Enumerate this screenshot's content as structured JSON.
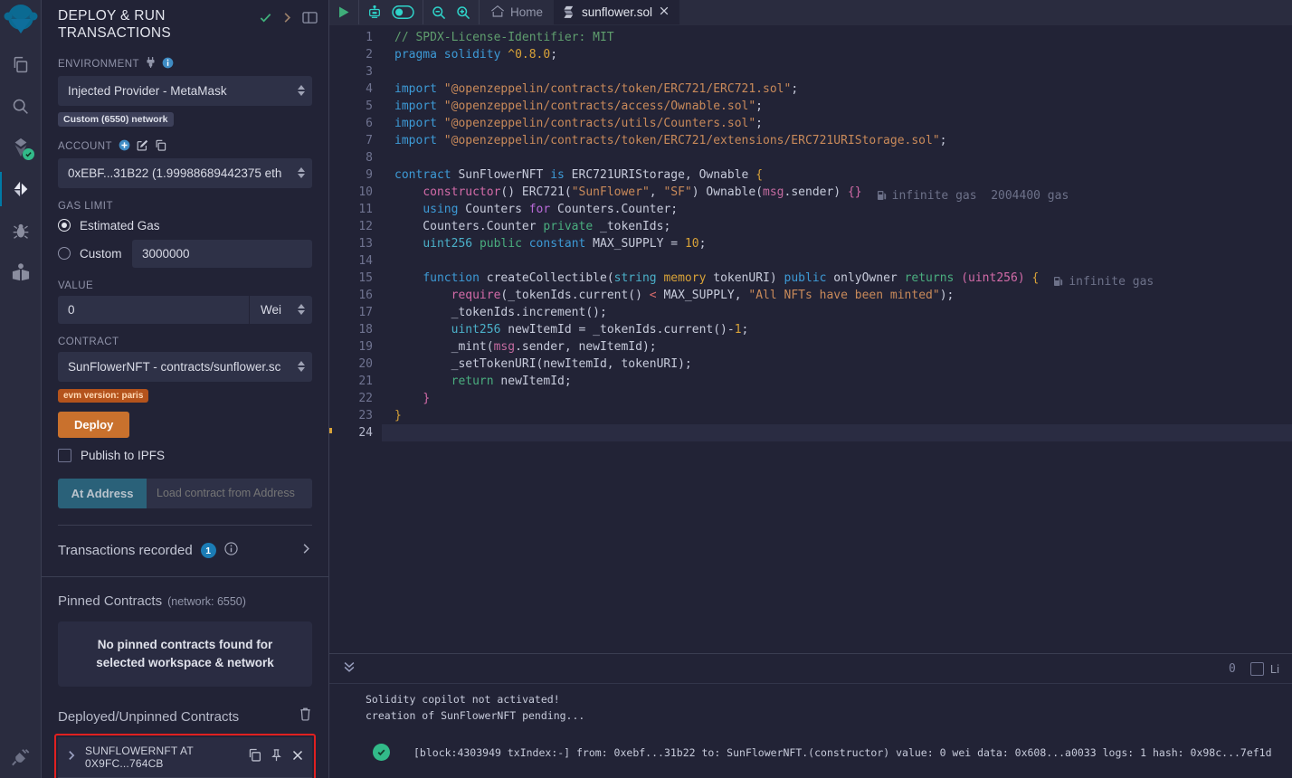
{
  "rail": {
    "items": [
      {
        "name": "remix-logo-icon",
        "label": "Remix"
      },
      {
        "name": "file-explorer-icon",
        "label": "File explorer"
      },
      {
        "name": "search-icon",
        "label": "Search in files"
      },
      {
        "name": "solidity-compiler-icon",
        "label": "Solidity compiler"
      },
      {
        "name": "deploy-run-icon",
        "label": "Deploy & run transactions"
      },
      {
        "name": "debugger-icon",
        "label": "Debugger"
      },
      {
        "name": "learneth-icon",
        "label": "LearnEth"
      }
    ],
    "bottom": {
      "name": "plugin-manager-icon",
      "label": "Plugin manager"
    }
  },
  "sidepanel": {
    "title": "DEPLOY & RUN TRANSACTIONS",
    "environment": {
      "label": "ENVIRONMENT",
      "value": "Injected Provider - MetaMask",
      "network_badge": "Custom (6550) network"
    },
    "account": {
      "label": "ACCOUNT",
      "value": "0xEBF...31B22 (1.99988689442375 eth"
    },
    "gas_limit": {
      "label": "GAS LIMIT",
      "estimated_label": "Estimated Gas",
      "custom_label": "Custom",
      "custom_value": "3000000",
      "selected": "estimated"
    },
    "value": {
      "label": "VALUE",
      "amount": "0",
      "unit": "Wei"
    },
    "contract": {
      "label": "CONTRACT",
      "value": "SunFlowerNFT - contracts/sunflower.sc",
      "evm_badge": "evm version: paris"
    },
    "deploy_button": "Deploy",
    "publish_ipfs_label": "Publish to IPFS",
    "at_address_button": "At Address",
    "at_address_placeholder": "Load contract from Address",
    "transactions_recorded": {
      "label": "Transactions recorded",
      "count": "1"
    },
    "pinned": {
      "title": "Pinned Contracts",
      "subtitle": "(network: 6550)",
      "empty_message": "No pinned contracts found for selected workspace & network"
    },
    "deployed": {
      "title": "Deployed/Unpinned Contracts",
      "items": [
        {
          "label": "SUNFLOWERNFT AT 0X9FC...764CB"
        }
      ]
    }
  },
  "toolbar": {
    "run_label": "Run script",
    "copilot_label": "Solidity copilot",
    "toggle_label": "Copilot toggle",
    "zoom_out_label": "Zoom out",
    "zoom_in_label": "Zoom in",
    "home_label": "Home",
    "tabs": [
      {
        "label": "sunflower.sol",
        "active": true
      }
    ]
  },
  "editor": {
    "cursor_line": 24,
    "total_lines": 24,
    "lines": [
      {
        "n": 1,
        "tokens": [
          {
            "t": "// SPDX-License-Identifier: MIT",
            "c": "k-comment"
          }
        ]
      },
      {
        "n": 2,
        "tokens": [
          {
            "t": "pragma",
            "c": "k-key"
          },
          {
            "t": " ",
            "c": ""
          },
          {
            "t": "solidity",
            "c": "k-key"
          },
          {
            "t": " ",
            "c": ""
          },
          {
            "t": "^0.8.0",
            "c": "k-num"
          },
          {
            "t": ";",
            "c": "k-ident"
          }
        ]
      },
      {
        "n": 3,
        "tokens": []
      },
      {
        "n": 4,
        "tokens": [
          {
            "t": "import",
            "c": "k-key"
          },
          {
            "t": " ",
            "c": ""
          },
          {
            "t": "\"@openzeppelin/contracts/token/ERC721/ERC721.sol\"",
            "c": "k-str"
          },
          {
            "t": ";",
            "c": "k-ident"
          }
        ]
      },
      {
        "n": 5,
        "tokens": [
          {
            "t": "import",
            "c": "k-key"
          },
          {
            "t": " ",
            "c": ""
          },
          {
            "t": "\"@openzeppelin/contracts/access/Ownable.sol\"",
            "c": "k-str"
          },
          {
            "t": ";",
            "c": "k-ident"
          }
        ]
      },
      {
        "n": 6,
        "tokens": [
          {
            "t": "import",
            "c": "k-key"
          },
          {
            "t": " ",
            "c": ""
          },
          {
            "t": "\"@openzeppelin/contracts/utils/Counters.sol\"",
            "c": "k-str"
          },
          {
            "t": ";",
            "c": "k-ident"
          }
        ]
      },
      {
        "n": 7,
        "tokens": [
          {
            "t": "import",
            "c": "k-key"
          },
          {
            "t": " ",
            "c": ""
          },
          {
            "t": "\"@openzeppelin/contracts/token/ERC721/extensions/ERC721URIStorage.sol\"",
            "c": "k-str"
          },
          {
            "t": ";",
            "c": "k-ident"
          }
        ]
      },
      {
        "n": 8,
        "tokens": []
      },
      {
        "n": 9,
        "tokens": [
          {
            "t": "contract",
            "c": "k-key"
          },
          {
            "t": " SunFlowerNFT ",
            "c": "k-ident"
          },
          {
            "t": "is",
            "c": "k-key"
          },
          {
            "t": " ERC721URIStorage, Ownable ",
            "c": "k-ident"
          },
          {
            "t": "{",
            "c": "k-brace"
          }
        ]
      },
      {
        "n": 10,
        "tokens": [
          {
            "t": "    ",
            "c": ""
          },
          {
            "t": "constructor",
            "c": "k-pink"
          },
          {
            "t": "() ERC721(",
            "c": "k-ident"
          },
          {
            "t": "\"SunFlower\"",
            "c": "k-str"
          },
          {
            "t": ", ",
            "c": "k-ident"
          },
          {
            "t": "\"SF\"",
            "c": "k-str"
          },
          {
            "t": ") Ownable(",
            "c": "k-ident"
          },
          {
            "t": "msg",
            "c": "k-msg"
          },
          {
            "t": ".sender) ",
            "c": "k-ident"
          },
          {
            "t": "{}",
            "c": "k-pink"
          }
        ],
        "gas": "infinite gas  2004400 gas"
      },
      {
        "n": 11,
        "tokens": [
          {
            "t": "    ",
            "c": ""
          },
          {
            "t": "using",
            "c": "k-key"
          },
          {
            "t": " Counters ",
            "c": "k-ident"
          },
          {
            "t": "for",
            "c": "k-key2"
          },
          {
            "t": " Counters.Counter;",
            "c": "k-ident"
          }
        ]
      },
      {
        "n": 12,
        "tokens": [
          {
            "t": "    Counters.Counter ",
            "c": "k-ident"
          },
          {
            "t": "private",
            "c": "k-green"
          },
          {
            "t": " _tokenIds;",
            "c": "k-ident"
          }
        ]
      },
      {
        "n": 13,
        "tokens": [
          {
            "t": "    ",
            "c": ""
          },
          {
            "t": "uint256",
            "c": "k-teal"
          },
          {
            "t": " ",
            "c": ""
          },
          {
            "t": "public",
            "c": "k-green"
          },
          {
            "t": " ",
            "c": ""
          },
          {
            "t": "constant",
            "c": "k-key"
          },
          {
            "t": " MAX_SUPPLY = ",
            "c": "k-ident"
          },
          {
            "t": "10",
            "c": "k-num"
          },
          {
            "t": ";",
            "c": "k-ident"
          }
        ]
      },
      {
        "n": 14,
        "tokens": []
      },
      {
        "n": 15,
        "tokens": [
          {
            "t": "    ",
            "c": ""
          },
          {
            "t": "function",
            "c": "k-key"
          },
          {
            "t": " createCollectible(",
            "c": "k-ident"
          },
          {
            "t": "string",
            "c": "k-teal"
          },
          {
            "t": " ",
            "c": ""
          },
          {
            "t": "memory",
            "c": "k-num"
          },
          {
            "t": " tokenURI) ",
            "c": "k-ident"
          },
          {
            "t": "public",
            "c": "k-key"
          },
          {
            "t": " onlyOwner ",
            "c": "k-ident"
          },
          {
            "t": "returns",
            "c": "k-green"
          },
          {
            "t": " ",
            "c": ""
          },
          {
            "t": "(uint256)",
            "c": "k-pink"
          },
          {
            "t": " ",
            "c": ""
          },
          {
            "t": "{",
            "c": "k-brace"
          }
        ],
        "gas": "infinite gas"
      },
      {
        "n": 16,
        "tokens": [
          {
            "t": "        ",
            "c": ""
          },
          {
            "t": "require",
            "c": "k-pink"
          },
          {
            "t": "(_tokenIds.current() ",
            "c": "k-ident"
          },
          {
            "t": "<",
            "c": "k-op"
          },
          {
            "t": " MAX_SUPPLY, ",
            "c": "k-ident"
          },
          {
            "t": "\"All NFTs have been minted\"",
            "c": "k-str"
          },
          {
            "t": ");",
            "c": "k-ident"
          }
        ]
      },
      {
        "n": 17,
        "tokens": [
          {
            "t": "        _tokenIds.increment();",
            "c": "k-ident"
          }
        ]
      },
      {
        "n": 18,
        "tokens": [
          {
            "t": "        ",
            "c": ""
          },
          {
            "t": "uint256",
            "c": "k-teal"
          },
          {
            "t": " newItemId = _tokenIds.current()-",
            "c": "k-ident"
          },
          {
            "t": "1",
            "c": "k-num"
          },
          {
            "t": ";",
            "c": "k-ident"
          }
        ]
      },
      {
        "n": 19,
        "tokens": [
          {
            "t": "        _mint(",
            "c": "k-ident"
          },
          {
            "t": "msg",
            "c": "k-msg"
          },
          {
            "t": ".sender, newItemId);",
            "c": "k-ident"
          }
        ]
      },
      {
        "n": 20,
        "tokens": [
          {
            "t": "        _setTokenURI(newItemId, tokenURI);",
            "c": "k-ident"
          }
        ]
      },
      {
        "n": 21,
        "tokens": [
          {
            "t": "        ",
            "c": ""
          },
          {
            "t": "return",
            "c": "k-green"
          },
          {
            "t": " newItemId;",
            "c": "k-ident"
          }
        ]
      },
      {
        "n": 22,
        "tokens": [
          {
            "t": "    ",
            "c": ""
          },
          {
            "t": "}",
            "c": "k-pink"
          }
        ]
      },
      {
        "n": 23,
        "tokens": [
          {
            "t": "}",
            "c": "k-brace"
          }
        ]
      },
      {
        "n": 24,
        "tokens": []
      }
    ]
  },
  "terminal": {
    "count": "0",
    "listen_label": "Li",
    "lines": [
      "Solidity copilot not activated!",
      "creation of SunFlowerNFT pending..."
    ],
    "transaction": "[block:4303949 txIndex:-]  from: 0xebf...31b22 to: SunFlowerNFT.(constructor) value: 0 wei data: 0x608...a0033 logs: 1 hash: 0x98c...7ef1d"
  },
  "colors": {
    "accent_orange": "#c9712d",
    "accent_teal": "#2a6179",
    "success_green": "#32ba89",
    "highlight_red": "#e02020",
    "badge_blue": "#1b7cb5"
  }
}
